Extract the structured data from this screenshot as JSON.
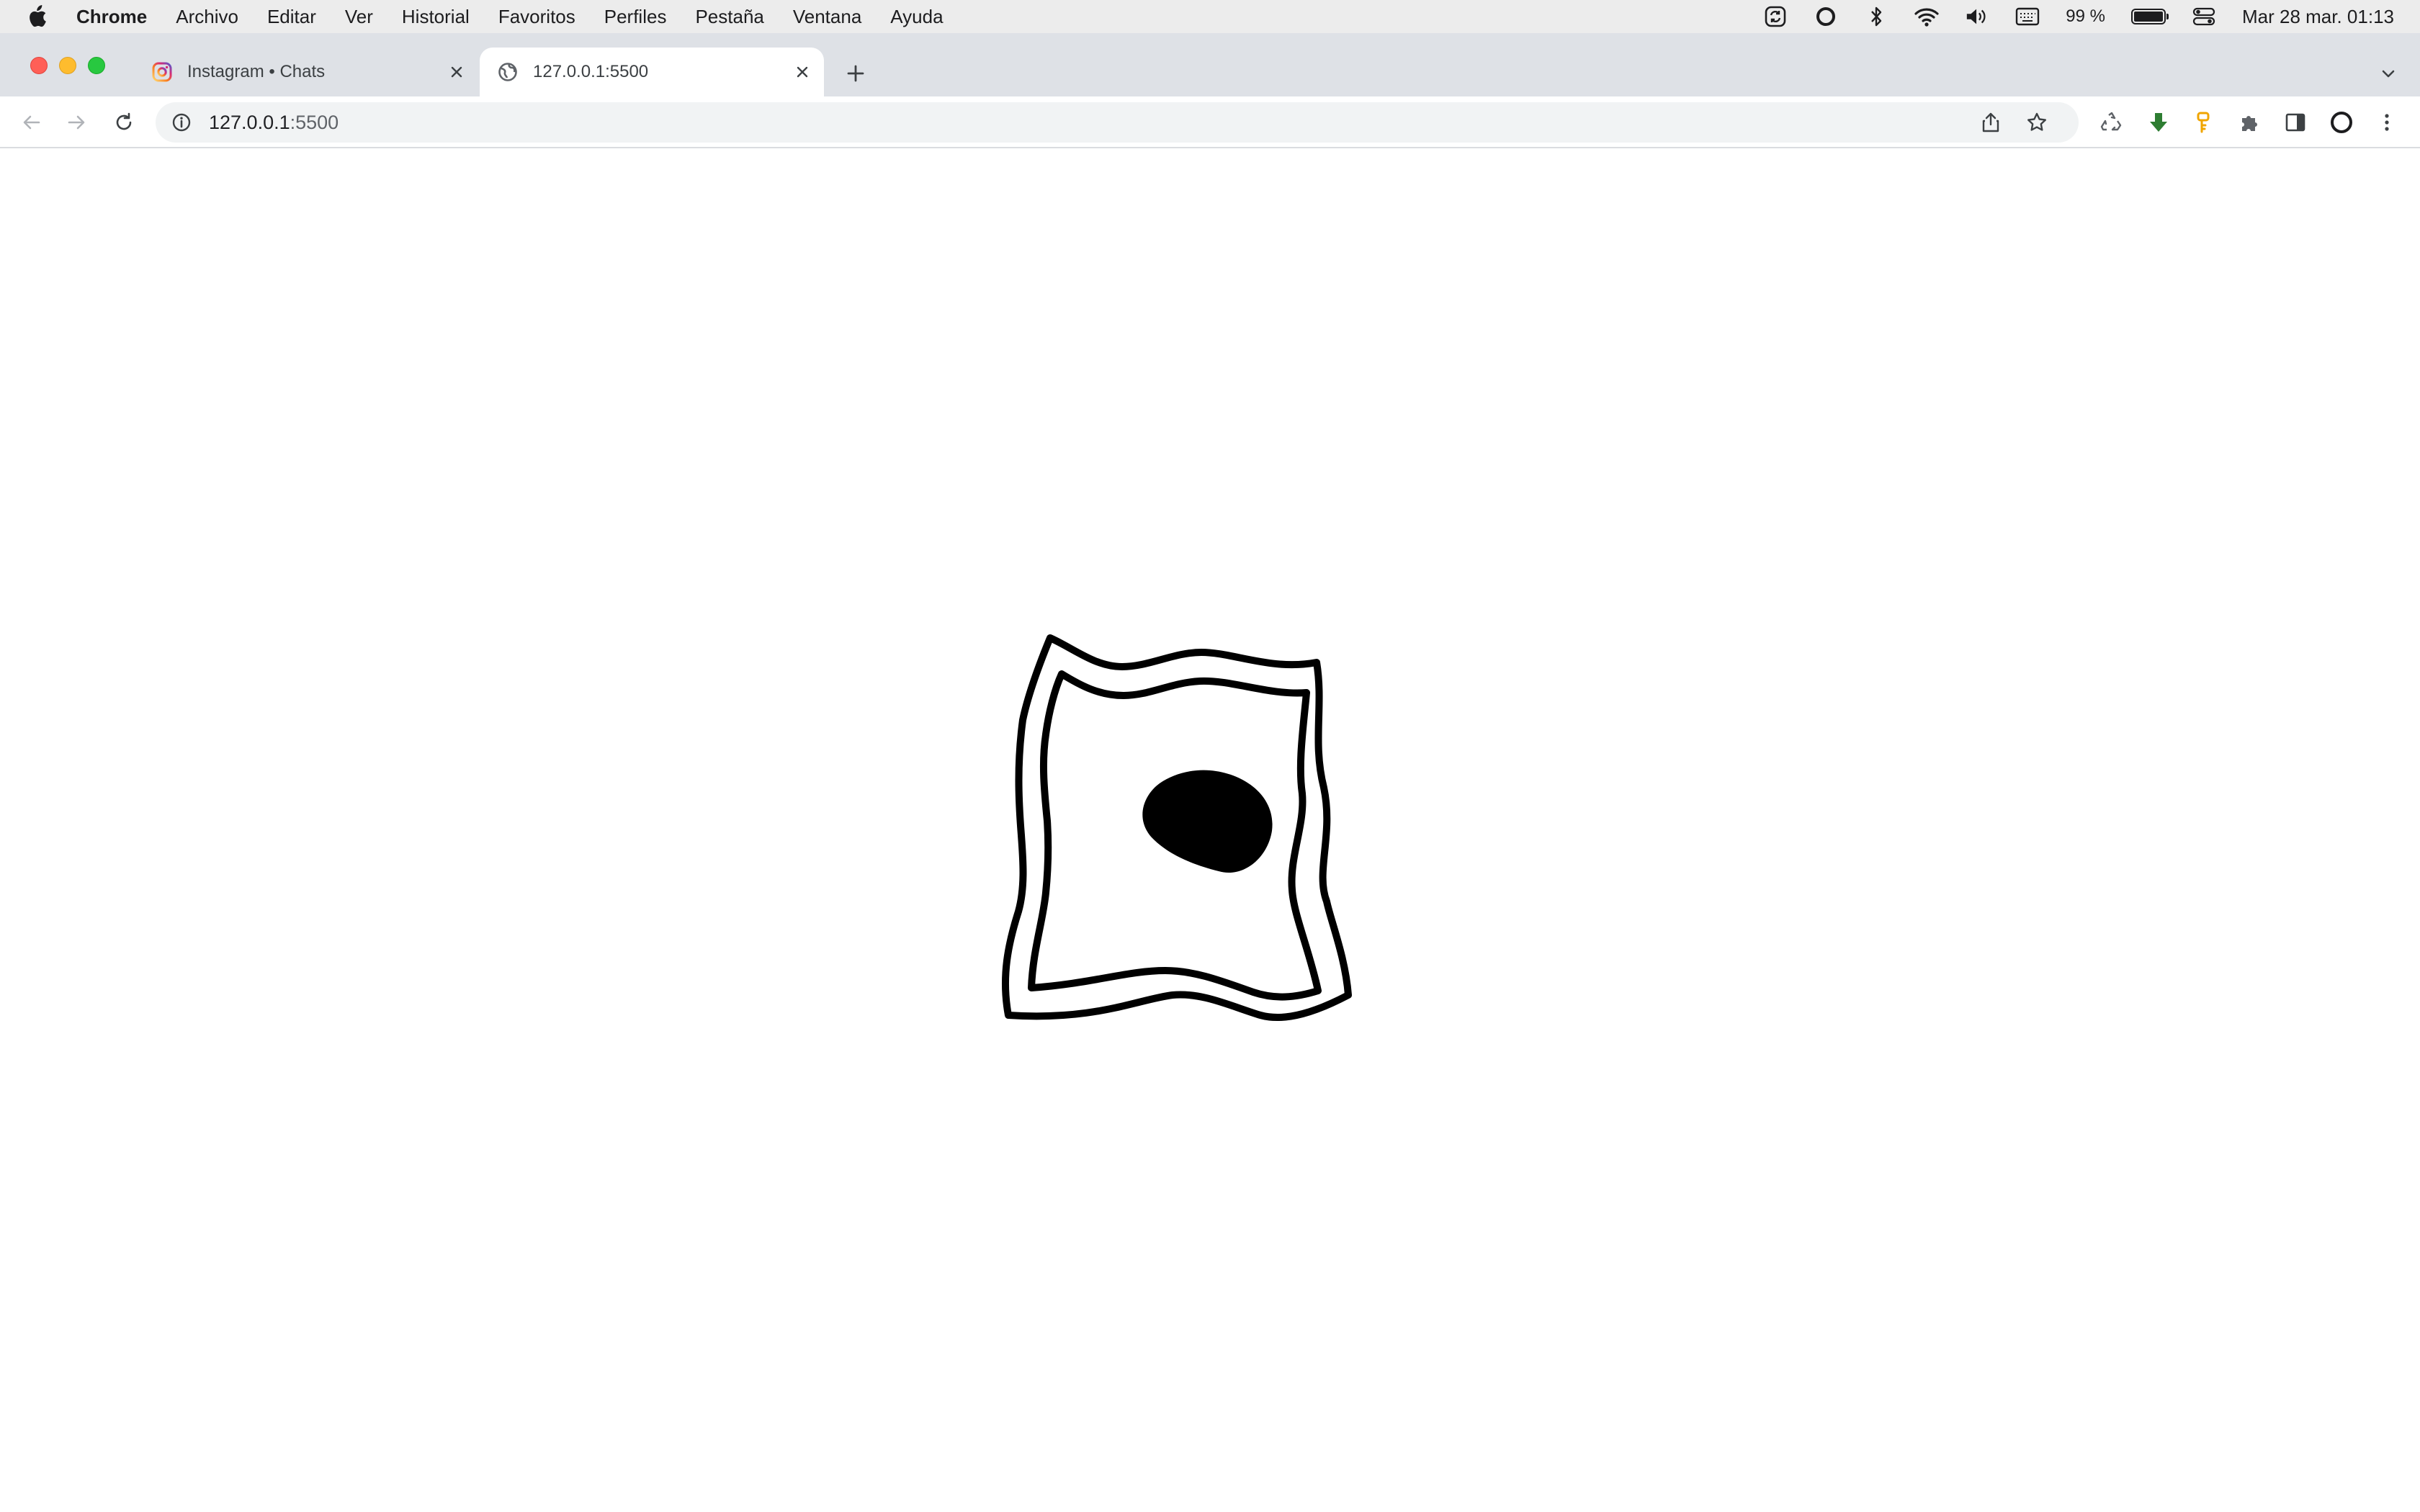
{
  "menubar": {
    "app_name": "Chrome",
    "items": [
      "Archivo",
      "Editar",
      "Ver",
      "Historial",
      "Favoritos",
      "Perfiles",
      "Pestaña",
      "Ventana",
      "Ayuda"
    ],
    "battery_percent": "99 %",
    "battery_level": 0.99,
    "datetime": "Mar 28 mar. 01:13"
  },
  "tabs": [
    {
      "title": "Instagram • Chats",
      "favicon": "instagram-icon",
      "active": false
    },
    {
      "title": "127.0.0.1:5500",
      "favicon": "globe-icon",
      "active": true
    }
  ],
  "toolbar": {
    "url_host": "127.0.0.1",
    "url_port": ":5500"
  },
  "colors": {
    "tabstrip": "#dee1e6",
    "menubar": "#ececec",
    "download_extension": "#2e7d32",
    "key_extension": "#f0a500"
  }
}
